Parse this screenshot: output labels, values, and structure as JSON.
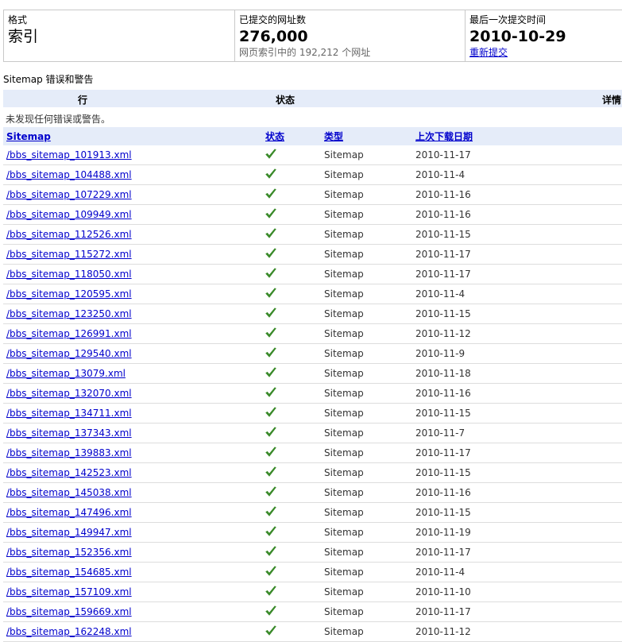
{
  "summary": {
    "format_label": "格式",
    "format_value": "索引",
    "submitted_label": "已提交的网址数",
    "submitted_value": "276,000",
    "indexed_text": "网页索引中的 192,212 个网址",
    "last_label": "最后一次提交时间",
    "last_value": "2010-10-29",
    "resubmit_link": "重新提交"
  },
  "errors": {
    "title": "Sitemap 错误和警告",
    "col_row": "行",
    "col_status": "状态",
    "col_details": "详情",
    "empty_text": "未发现任何错误或警告。"
  },
  "table": {
    "headers": {
      "sitemap": "Sitemap",
      "status": "状态",
      "type": "类型",
      "last_download": "上次下载日期"
    },
    "rows": [
      {
        "file": "/bbs_sitemap_101913.xml",
        "type": "Sitemap",
        "date": "2010-11-17"
      },
      {
        "file": "/bbs_sitemap_104488.xml",
        "type": "Sitemap",
        "date": "2010-11-4"
      },
      {
        "file": "/bbs_sitemap_107229.xml",
        "type": "Sitemap",
        "date": "2010-11-16"
      },
      {
        "file": "/bbs_sitemap_109949.xml",
        "type": "Sitemap",
        "date": "2010-11-16"
      },
      {
        "file": "/bbs_sitemap_112526.xml",
        "type": "Sitemap",
        "date": "2010-11-15"
      },
      {
        "file": "/bbs_sitemap_115272.xml",
        "type": "Sitemap",
        "date": "2010-11-17"
      },
      {
        "file": "/bbs_sitemap_118050.xml",
        "type": "Sitemap",
        "date": "2010-11-17"
      },
      {
        "file": "/bbs_sitemap_120595.xml",
        "type": "Sitemap",
        "date": "2010-11-4"
      },
      {
        "file": "/bbs_sitemap_123250.xml",
        "type": "Sitemap",
        "date": "2010-11-15"
      },
      {
        "file": "/bbs_sitemap_126991.xml",
        "type": "Sitemap",
        "date": "2010-11-12"
      },
      {
        "file": "/bbs_sitemap_129540.xml",
        "type": "Sitemap",
        "date": "2010-11-9"
      },
      {
        "file": "/bbs_sitemap_13079.xml",
        "type": "Sitemap",
        "date": "2010-11-18"
      },
      {
        "file": "/bbs_sitemap_132070.xml",
        "type": "Sitemap",
        "date": "2010-11-16"
      },
      {
        "file": "/bbs_sitemap_134711.xml",
        "type": "Sitemap",
        "date": "2010-11-15"
      },
      {
        "file": "/bbs_sitemap_137343.xml",
        "type": "Sitemap",
        "date": "2010-11-7"
      },
      {
        "file": "/bbs_sitemap_139883.xml",
        "type": "Sitemap",
        "date": "2010-11-17"
      },
      {
        "file": "/bbs_sitemap_142523.xml",
        "type": "Sitemap",
        "date": "2010-11-15"
      },
      {
        "file": "/bbs_sitemap_145038.xml",
        "type": "Sitemap",
        "date": "2010-11-16"
      },
      {
        "file": "/bbs_sitemap_147496.xml",
        "type": "Sitemap",
        "date": "2010-11-15"
      },
      {
        "file": "/bbs_sitemap_149947.xml",
        "type": "Sitemap",
        "date": "2010-11-19"
      },
      {
        "file": "/bbs_sitemap_152356.xml",
        "type": "Sitemap",
        "date": "2010-11-17"
      },
      {
        "file": "/bbs_sitemap_154685.xml",
        "type": "Sitemap",
        "date": "2010-11-4"
      },
      {
        "file": "/bbs_sitemap_157109.xml",
        "type": "Sitemap",
        "date": "2010-11-10"
      },
      {
        "file": "/bbs_sitemap_159669.xml",
        "type": "Sitemap",
        "date": "2010-11-17"
      },
      {
        "file": "/bbs_sitemap_162248.xml",
        "type": "Sitemap",
        "date": "2010-11-12"
      }
    ]
  },
  "icons": {
    "status": "check-icon",
    "status_color": "#3a8a2a"
  }
}
